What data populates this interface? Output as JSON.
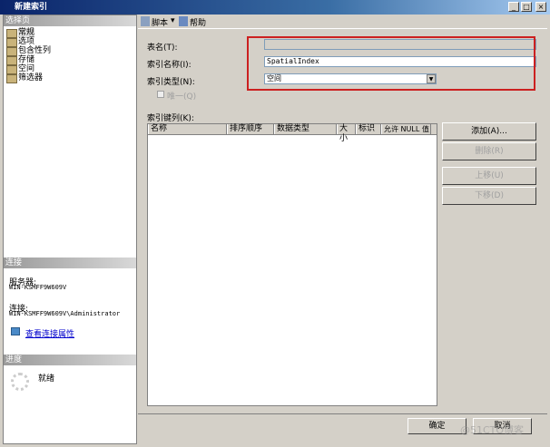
{
  "window": {
    "title": "新建索引",
    "min": "_",
    "max": "□",
    "close": "×"
  },
  "left": {
    "header": "选择页",
    "items": [
      "常规",
      "选项",
      "包含性列",
      "存储",
      "空间",
      "筛选器"
    ],
    "connection": {
      "header": "连接",
      "server_label": "服务器:",
      "server": "WIN-KSMFF9W609V",
      "conn_label": "连接:",
      "conn": "WIN-KSMFF9W609V\\Administrator",
      "link": "查看连接属性"
    },
    "progress": {
      "header": "进度",
      "status": "就绪"
    }
  },
  "toolbar": {
    "script": "脚本",
    "help": "帮助"
  },
  "form": {
    "table_label": "表名(T):",
    "table_value": "",
    "name_label": "索引名称(I):",
    "name_value": "SpatialIndex",
    "type_label": "索引类型(N):",
    "type_value": "空间",
    "unique_label": "唯一(Q)",
    "keys_label": "索引键列(K):"
  },
  "grid": {
    "columns": [
      "名称",
      "排序顺序",
      "数据类型",
      "大小",
      "标识",
      "允许 NULL 值"
    ]
  },
  "buttons": {
    "add": "添加(A)...",
    "remove": "删除(R)",
    "up": "上移(U)",
    "down": "下移(D)",
    "ok": "确定",
    "cancel": "取消"
  },
  "watermark": "@51CTO博客"
}
